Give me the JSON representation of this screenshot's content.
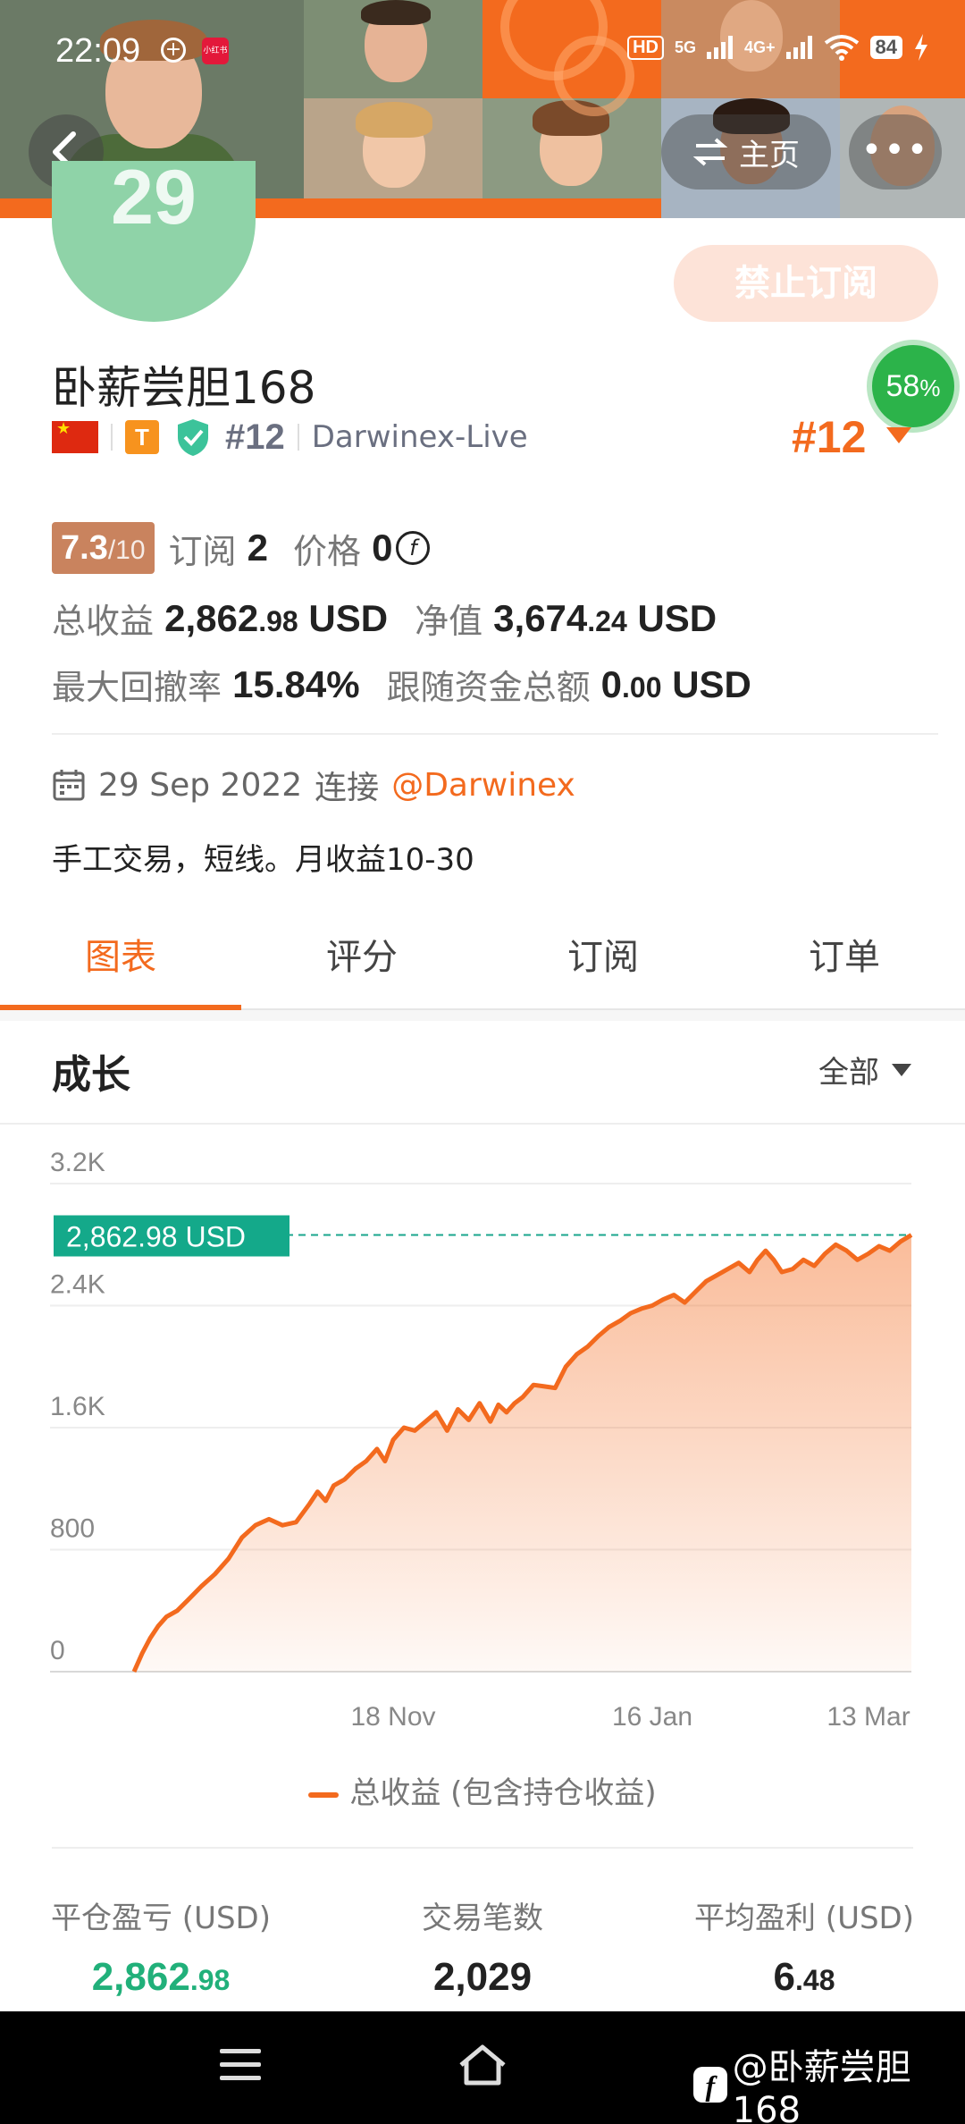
{
  "status": {
    "time": "22:09",
    "hd": "HD",
    "net1": "5G",
    "net2": "4G+",
    "battery": "84",
    "app_badge": "小红书"
  },
  "header": {
    "home_label": "主页",
    "more_label": "•••",
    "accent": "#f36a1e"
  },
  "profile": {
    "avatar_text": "29",
    "subscribe_label": "禁止订阅",
    "name": "卧薪尝胆168",
    "badge_letter": "T",
    "rank_small": "#12",
    "broker": "Darwinex-Live",
    "rank_big": "#12",
    "pct_value": "58",
    "pct_unit": "%"
  },
  "stats": {
    "score_main": "7.3",
    "score_den": "/10",
    "subs_label": "订阅",
    "subs_value": "2",
    "price_label": "价格",
    "price_value": "0",
    "coin_symbol": "f",
    "total_label": "总收益",
    "total_int": "2,862",
    "total_dec": ".98",
    "total_unit": "USD",
    "equity_label": "净值",
    "equity_int": "3,674",
    "equity_dec": ".24",
    "equity_unit": "USD",
    "dd_label": "最大回撤率",
    "dd_value": "15.84%",
    "follow_label": "跟随资金总额",
    "follow_int": "0",
    "follow_dec": ".00",
    "follow_unit": "USD"
  },
  "connect": {
    "date": "29 Sep 2022",
    "verb": "连接",
    "mention": "@Darwinex"
  },
  "description": "手工交易，短线。月收益10-30",
  "tabs": [
    {
      "label": "图表",
      "active": true
    },
    {
      "label": "评分",
      "active": false
    },
    {
      "label": "订阅",
      "active": false
    },
    {
      "label": "订单",
      "active": false
    }
  ],
  "section": {
    "title": "成长",
    "filter": "全部"
  },
  "chart_data": {
    "type": "area",
    "series": [
      {
        "name": "总收益 (包含持仓收益)",
        "color": "#f36a1e",
        "x": [
          0,
          3,
          6,
          9,
          12,
          16,
          20,
          25,
          30,
          35,
          40,
          45,
          50,
          55,
          60,
          65,
          68,
          71,
          74,
          78,
          82,
          86,
          90,
          93,
          96,
          100,
          104,
          108,
          112,
          116,
          120,
          124,
          128,
          132,
          135,
          138,
          141,
          144,
          148,
          152,
          156,
          160,
          164,
          168,
          172,
          176,
          180,
          184,
          188,
          192,
          196,
          200,
          204,
          208,
          212,
          216,
          220,
          224,
          228,
          231,
          234,
          237,
          240,
          244,
          248,
          252,
          256,
          260,
          264,
          268,
          272,
          276,
          280,
          284,
          288
        ],
        "values": [
          0,
          120,
          220,
          300,
          360,
          400,
          470,
          560,
          640,
          740,
          880,
          960,
          1000,
          960,
          980,
          1100,
          1180,
          1120,
          1220,
          1260,
          1330,
          1380,
          1460,
          1380,
          1520,
          1600,
          1580,
          1640,
          1700,
          1580,
          1720,
          1650,
          1760,
          1640,
          1750,
          1700,
          1760,
          1800,
          1880,
          1870,
          1860,
          2000,
          2080,
          2130,
          2200,
          2260,
          2300,
          2350,
          2380,
          2400,
          2440,
          2470,
          2420,
          2490,
          2560,
          2600,
          2640,
          2680,
          2620,
          2700,
          2760,
          2700,
          2620,
          2640,
          2700,
          2660,
          2740,
          2800,
          2760,
          2700,
          2740,
          2790,
          2760,
          2820,
          2862.98
        ]
      }
    ],
    "x_ticks": [
      "18 Nov",
      "16 Jan",
      "13 Mar"
    ],
    "y_ticks": [
      "0",
      "800",
      "1.6K",
      "2.4K",
      "3.2K"
    ],
    "ylim": [
      0,
      3200
    ],
    "current_label": "2,862.98 USD",
    "current_value": 2862.98,
    "grid": true,
    "legend": "bottom-center"
  },
  "summary": [
    {
      "label": "平仓盈亏 (USD)",
      "int": "2,862",
      "dec": ".98",
      "green": true
    },
    {
      "label": "交易笔数",
      "int": "2,029",
      "dec": "",
      "green": false
    },
    {
      "label": "平均盈利 (USD)",
      "int": "6",
      "dec": ".48",
      "green": false
    }
  ],
  "watermark": {
    "icon": "f",
    "text": "@卧薪尝胆168"
  }
}
